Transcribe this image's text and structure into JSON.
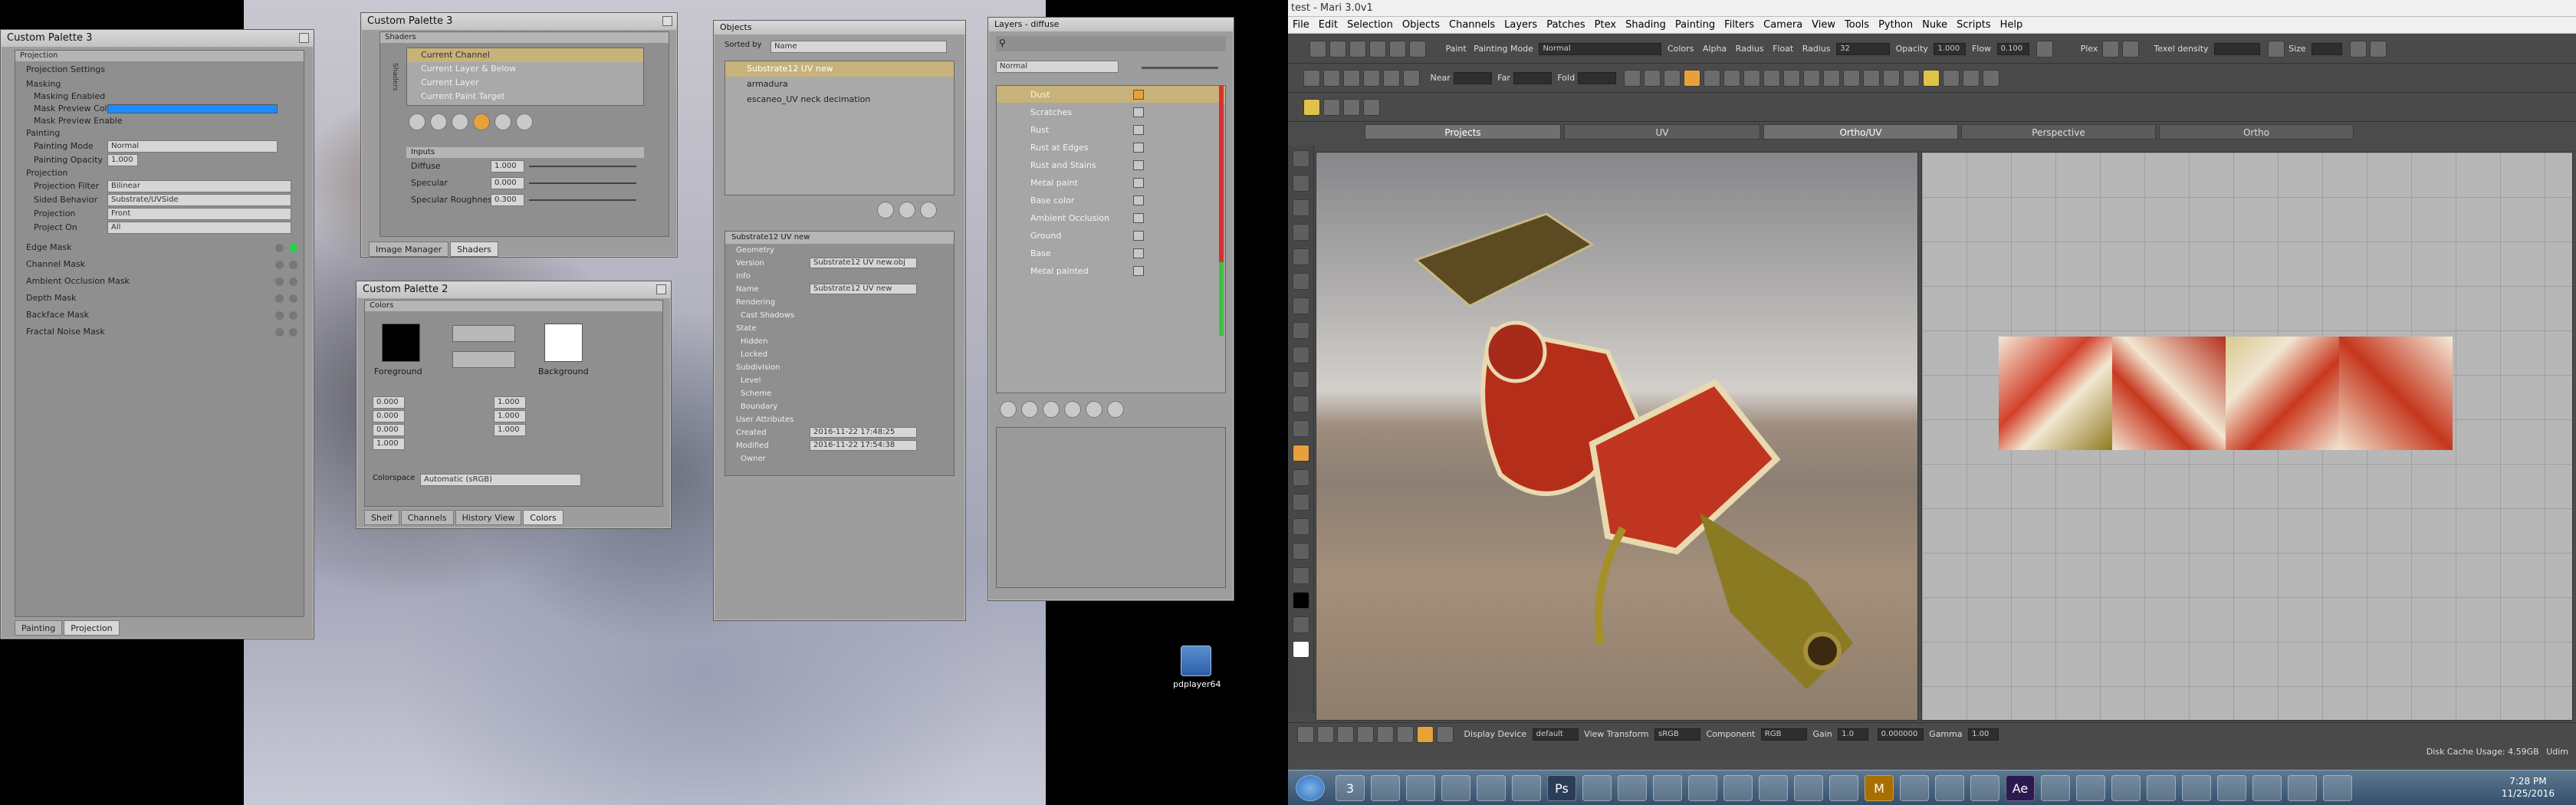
{
  "left_palettes": {
    "palette_projection": {
      "title": "Custom Palette 3",
      "subtitle": "Projection",
      "section": "Projection Settings",
      "rows": [
        "Masking",
        "Masking Enabled",
        "Mask Preview Color",
        "Mask Preview Enable",
        "Painting",
        "Painting Mode",
        "Painting Opacity",
        "Projection",
        "Projection Filter",
        "Sided Behavior",
        "Projection",
        "Project On"
      ],
      "painting_mode_value": "Normal",
      "painting_opacity_value": "1.000",
      "projection_filter_value": "Bilinear",
      "sided_behavior_value": "Substrate/UVSide",
      "projection_value": "Front",
      "project_on_value": "All",
      "masks": [
        "Edge Mask",
        "Channel Mask",
        "Ambient Occlusion Mask",
        "Depth Mask",
        "Backface Mask",
        "Fractal Noise Mask"
      ],
      "tabs": [
        "Painting",
        "Projection"
      ]
    },
    "palette_shaders": {
      "title": "Custom Palette 3",
      "subtitle": "Shaders",
      "side_label": "Shaders",
      "list": [
        "Current Channel",
        "Current Layer & Below",
        "Current Layer",
        "Current Paint Target"
      ],
      "inputs_header": "Inputs",
      "inputs": [
        {
          "label": "Diffuse",
          "value": "1.000"
        },
        {
          "label": "Specular",
          "value": "0.000"
        },
        {
          "label": "Specular Roughness",
          "value": "0.300"
        }
      ],
      "tabs": [
        "Image Manager",
        "Shaders"
      ]
    },
    "palette_colors": {
      "title": "Custom Palette 2",
      "subtitle": "Colors",
      "foreground": "Foreground",
      "background": "Background",
      "fg_values": [
        "0.000",
        "0.000",
        "0.000",
        "1.000"
      ],
      "bg_values": [
        "1.000",
        "1.000",
        "1.000"
      ],
      "colorspace_label": "Colorspace",
      "colorspace_value": "Automatic (sRGB)",
      "tabs": [
        "Shelf",
        "Channels",
        "History View",
        "Colors"
      ]
    },
    "panel_objects": {
      "title": "Objects",
      "sorted_by_label": "Sorted by",
      "sorted_by_value": "Name",
      "items": [
        "Substrate12 UV new",
        "armadura",
        "escaneo_UV neck decimation"
      ],
      "props_title": "Substrate12 UV new",
      "props_rows": [
        "Geometry",
        "Version",
        "Info",
        "Name",
        "Rendering",
        "Cast Shadows",
        "State",
        "Hidden",
        "Locked",
        "Subdivision",
        "Level",
        "Scheme",
        "Boundary",
        "User Attributes",
        "Created",
        "Modified",
        "Owner"
      ],
      "version_value": "Substrate12 UV new.obj",
      "name_value": "Substrate12 UV new",
      "created_value": "2016-11-22 17:48:25",
      "modified_value": "2016-11-22 17:54:38"
    },
    "panel_layers": {
      "title": "Layers - diffuse",
      "blend_value": "Normal",
      "items": [
        "Dust",
        "Scratches",
        "Rust",
        "Rust at Edges",
        "Rust and Stains",
        "Metal paint",
        "Base color",
        "Ambient Occlusion",
        "Ground",
        "Base",
        "Metal painted"
      ]
    },
    "desktop_icon": "pdplayer64"
  },
  "mari": {
    "title": "test - Mari 3.0v1",
    "menu": [
      "File",
      "Edit",
      "Selection",
      "Objects",
      "Channels",
      "Layers",
      "Patches",
      "Ptex",
      "Shading",
      "Painting",
      "Filters",
      "Camera",
      "View",
      "Tools",
      "Python",
      "Nuke",
      "Scripts",
      "Help"
    ],
    "toolbar1": {
      "paint_label": "Paint",
      "painting_mode_label": "Painting Mode",
      "painting_mode_value": "Normal",
      "colors_label": "Colors",
      "alpha_label": "Alpha",
      "radius_label": "Radius",
      "float_label": "Float",
      "radius2_label": "Radius",
      "radius2_value": "32",
      "opacity_label": "Opacity",
      "opacity_value": "1.000",
      "flow_label": "Flow",
      "flow_value": "0.100",
      "plex_label": "Plex",
      "texel_label": "Texel density",
      "size_label": "Size"
    },
    "toolbar2": {
      "near_label": "Near",
      "far_label": "Far",
      "fold_label": "Fold"
    },
    "view_tabs": [
      "Projects",
      "UV",
      "Ortho/UV",
      "Perspective",
      "Ortho"
    ],
    "status": {
      "display_device_label": "Display Device",
      "display_device_value": "default",
      "view_transform_label": "View Transform",
      "view_transform_value": "sRGB",
      "component_label": "Component",
      "component_value": "RGB",
      "gain_label": "Gain",
      "gain_value": "1.0",
      "gamma_value": "0.000000",
      "gamma_label": "Gamma",
      "gamma2_value": "1.00",
      "disk_cache": "Disk Cache Usage: 4.59GB",
      "udim": "Udim"
    }
  },
  "taskbar": {
    "apps": [
      "3",
      "Ps",
      "Ae",
      "M"
    ],
    "time": "7:28 PM",
    "date": "11/25/2016"
  }
}
